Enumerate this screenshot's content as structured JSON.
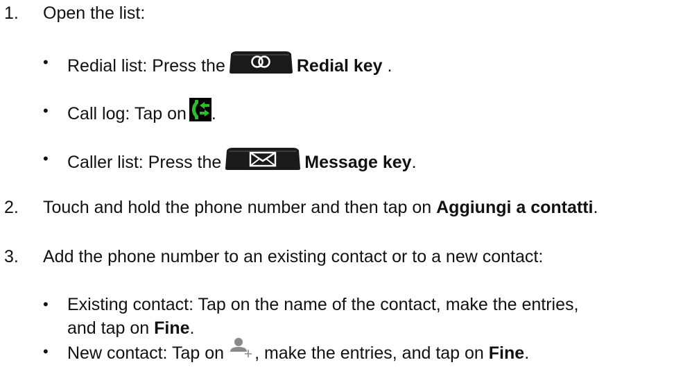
{
  "steps": [
    {
      "number": "1.",
      "text": "Open the list:"
    },
    {
      "number": "2.",
      "text_before": "Touch and hold the phone number and then tap on ",
      "bold": "Aggiungi a contatti",
      "text_after": "."
    },
    {
      "number": "3.",
      "text": "Add the phone number to an existing contact or to a new contact:"
    }
  ],
  "step1_items": {
    "redial": {
      "bullet": "•",
      "text_before": "Redial list: Press the",
      "bold": "Redial key",
      "text_after": " ."
    },
    "calllog": {
      "bullet": "•",
      "text_before": "Call log: Tap on",
      "text_after": "."
    },
    "caller": {
      "bullet": "•",
      "text_before": "Caller list: Press the",
      "bold": "Message key",
      "text_after": "."
    }
  },
  "step3_items": {
    "existing": {
      "bullet": "•",
      "line1": "Existing contact: Tap on the name of the contact, make the entries,",
      "line2_before": "and tap on ",
      "line2_bold": "Fine",
      "line2_after": "."
    },
    "new": {
      "bullet": "•",
      "text_before": "New contact: Tap on",
      "text_middle": ", make the entries, and tap on ",
      "bold": "Fine",
      "text_after": "."
    }
  },
  "icons": {
    "redial_key": "redial-key-icon",
    "call_log": "call-log-icon",
    "message_key": "message-key-icon",
    "add_contact": "add-contact-icon"
  },
  "colors": {
    "text": "#111111",
    "call_log_bg": "#000000",
    "call_log_arrows": "#27c227",
    "key_body": "#1a1a1a",
    "contact_icon": "#8a8a8a"
  }
}
